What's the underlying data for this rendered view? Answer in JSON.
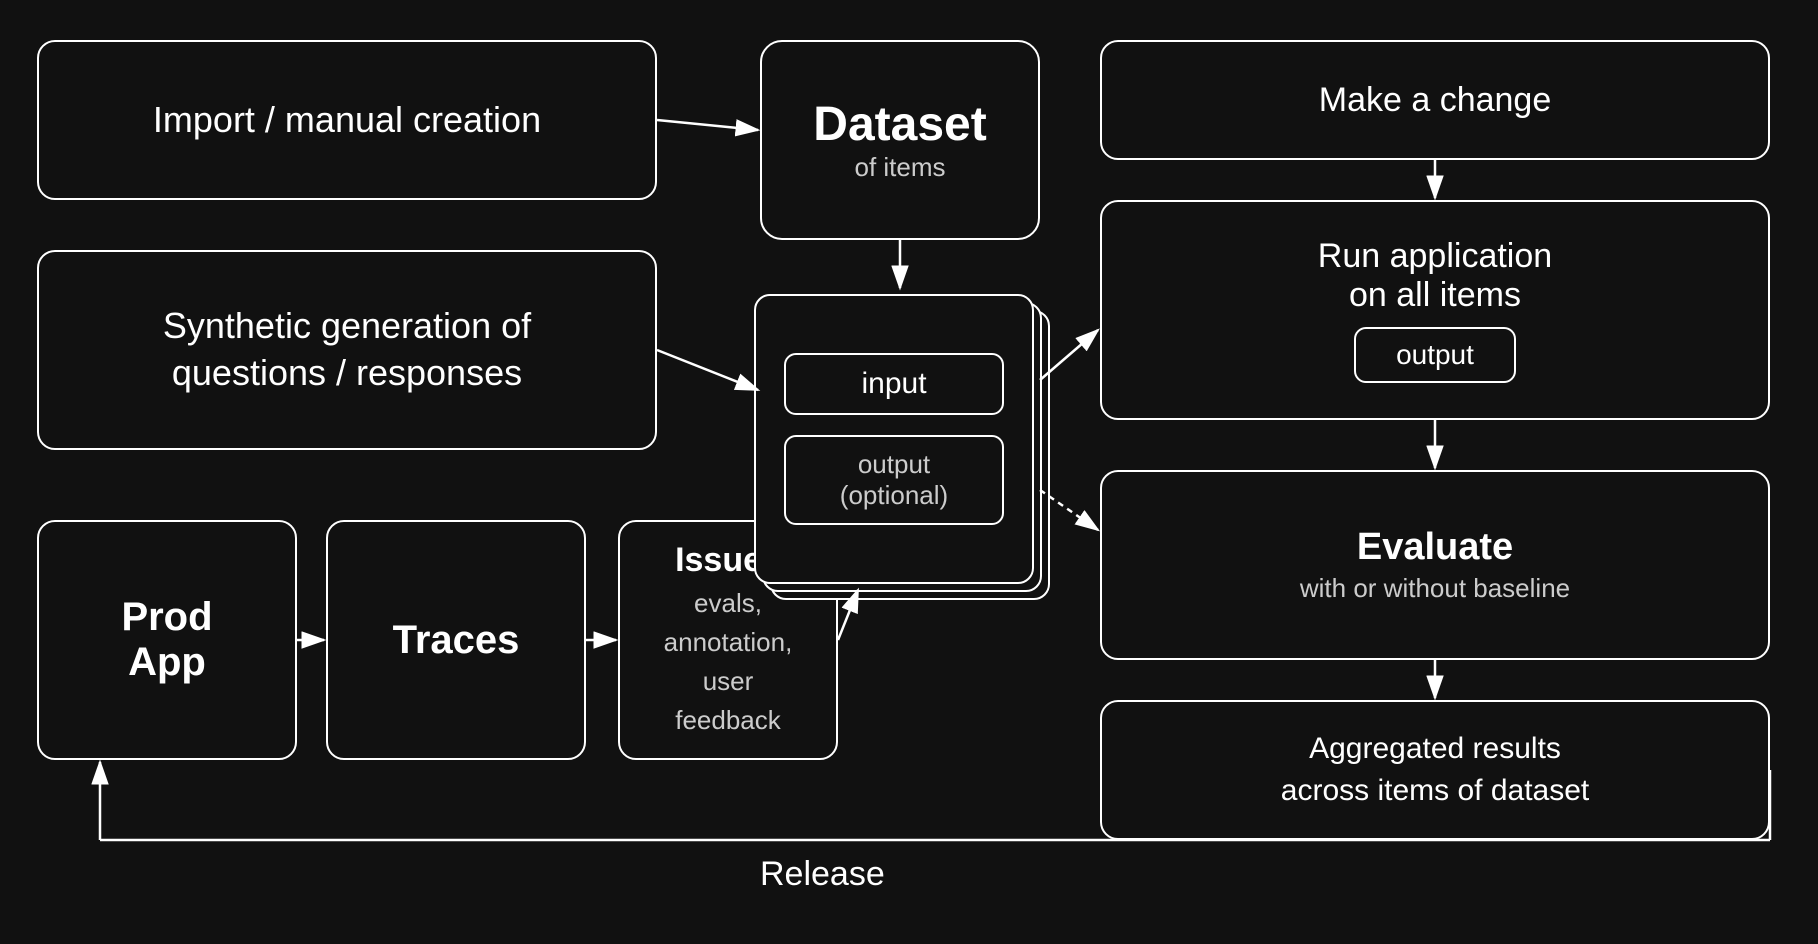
{
  "boxes": {
    "import": {
      "label": "Import / manual creation"
    },
    "synthetic": {
      "label": "Synthetic generation of\nquestions / responses"
    },
    "prodApp": {
      "label": "Prod\nApp"
    },
    "traces": {
      "label": "Traces"
    },
    "issues": {
      "title": "Issues",
      "subtitle": "evals,\nannotation,\nuser\nfeedback"
    },
    "dataset": {
      "title": "Dataset",
      "subtitle": "of items"
    },
    "cardInput": {
      "label": "input"
    },
    "cardOutput": {
      "label": "output\n(optional)"
    },
    "makeChange": {
      "label": "Make a change"
    },
    "runApp": {
      "title": "Run application\non all items",
      "output": "output"
    },
    "evaluate": {
      "title": "Evaluate",
      "subtitle": "with or without baseline"
    },
    "aggregated": {
      "label": "Aggregated results\nacross items of dataset"
    },
    "release": {
      "label": "Release"
    }
  }
}
